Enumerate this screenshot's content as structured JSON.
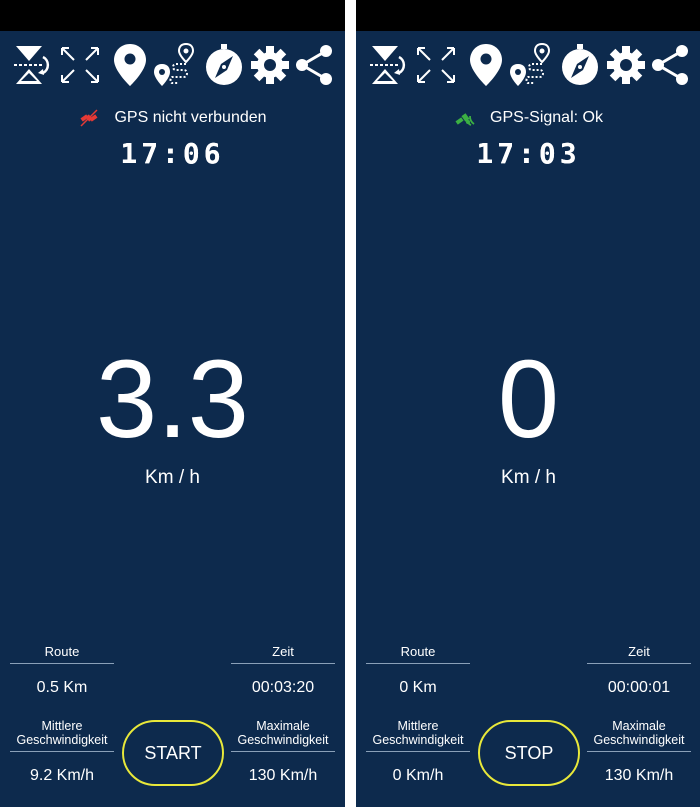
{
  "screens": [
    {
      "toolbar_icons": [
        "hourglass-rotate-icon",
        "expand-icon",
        "location-pin-icon",
        "route-icon",
        "compass-icon",
        "gear-icon",
        "share-icon"
      ],
      "gps_status": "GPS nicht verbunden",
      "gps_icon": "satellite-off-icon",
      "gps_icon_color": "#e53935",
      "clock": "17:06",
      "speed": "3.3",
      "unit": "Km / h",
      "route_label": "Route",
      "route_value": "0.5 Km",
      "time_label": "Zeit",
      "time_value": "00:03:20",
      "avg_label_1": "Mittlere",
      "avg_label_2": "Geschwindigkeit",
      "avg_value": "9.2 Km/h",
      "max_label_1": "Maximale",
      "max_label_2": "Geschwindigkeit",
      "max_value": "130 Km/h",
      "button_label": "START"
    },
    {
      "toolbar_icons": [
        "hourglass-rotate-icon",
        "expand-icon",
        "location-pin-icon",
        "route-icon",
        "compass-icon",
        "gear-icon",
        "share-icon"
      ],
      "gps_status": "GPS-Signal: Ok",
      "gps_icon": "satellite-ok-icon",
      "gps_icon_color": "#3cb043",
      "clock": "17:03",
      "speed": "0",
      "unit": "Km / h",
      "route_label": "Route",
      "route_value": "0 Km",
      "time_label": "Zeit",
      "time_value": "00:00:01",
      "avg_label_1": "Mittlere",
      "avg_label_2": "Geschwindigkeit",
      "avg_value": "0 Km/h",
      "max_label_1": "Maximale",
      "max_label_2": "Geschwindigkeit",
      "max_value": "130 Km/h",
      "button_label": "STOP"
    }
  ],
  "colors": {
    "background": "#0d2a4d",
    "button_border": "#e8e83a",
    "text": "#ffffff"
  }
}
